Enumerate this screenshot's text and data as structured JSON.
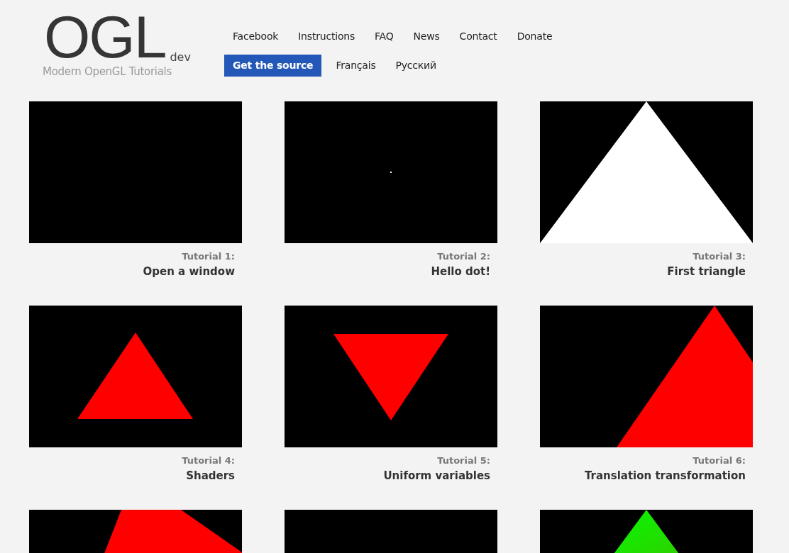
{
  "logo": {
    "title": "OGL",
    "suffix": "dev",
    "tagline": "Modern OpenGL Tutorials"
  },
  "main_menu": [
    "Facebook",
    "Instructions",
    "FAQ",
    "News",
    "Contact",
    "Donate"
  ],
  "secondary_menu": [
    {
      "label": "Get the source",
      "kind": "button"
    },
    {
      "label": "Français",
      "kind": "link"
    },
    {
      "label": "Русский",
      "kind": "link"
    }
  ],
  "tutorials": [
    {
      "kind": "blank",
      "number": "Tutorial 1:",
      "title": "Open a window"
    },
    {
      "kind": "dot",
      "number": "Tutorial 2:",
      "title": "Hello dot!"
    },
    {
      "kind": "white-triangle",
      "number": "Tutorial 3:",
      "title": "First triangle"
    },
    {
      "kind": "red-triangle",
      "number": "Tutorial 4:",
      "title": "Shaders"
    },
    {
      "kind": "red-inverted-triangle",
      "number": "Tutorial 5:",
      "title": "Uniform variables"
    },
    {
      "kind": "red-shifted-triangle",
      "number": "Tutorial 6:",
      "title": "Translation transformation"
    },
    {
      "kind": "red-tilted-triangle"
    },
    {
      "kind": "blank"
    },
    {
      "kind": "green-triangle"
    }
  ]
}
